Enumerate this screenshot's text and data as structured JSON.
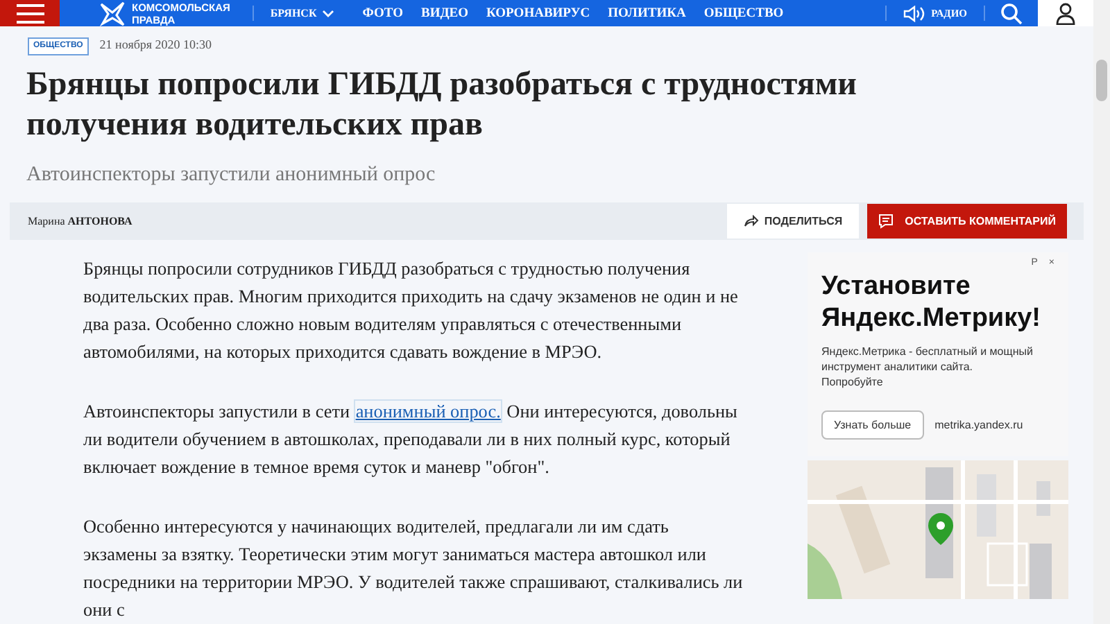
{
  "header": {
    "logo_line_1": "КОМСОМОЛЬСКАЯ",
    "logo_line_2": "ПРАВДА",
    "region": "БРЯНСК",
    "nav": [
      "ФОТО",
      "ВИДЕО",
      "КОРОНАВИРУС",
      "ПОЛИТИКА",
      "ОБЩЕСТВО"
    ],
    "radio": "РАДИО"
  },
  "article": {
    "tag": "ОБЩЕСТВО",
    "date": "21 ноября 2020 10:30",
    "title": "Брянцы попросили ГИБДД разобраться с трудностями получения водительских прав",
    "subtitle": "Автоинспекторы запустили анонимный опрос",
    "author_first": "Марина",
    "author_last": "АНТОНОВА",
    "share": "ПОДЕЛИТЬСЯ",
    "comment": "ОСТАВИТЬ КОММЕНТАРИЙ",
    "paragraphs": [
      {
        "parts": [
          {
            "text": "Брянцы попросили сотрудников ГИБДД разобраться с трудностью получения водительских прав. Многим приходится приходить на сдачу экзаменов не один и не два раза. Особенно сложно новым водителям управляться с отечественными автомобилями, на которых приходится сдавать вождение в МРЭО."
          }
        ]
      },
      {
        "parts": [
          {
            "text": "Автоинспекторы запустили в сети "
          },
          {
            "text": "анонимный опрос.",
            "link": true
          },
          {
            "text": " Они интересуются, довольны ли водители обучением в автошколах, преподавали ли в них полный курс, который включает вождение в темное время суток и маневр \"обгон\"."
          }
        ]
      },
      {
        "parts": [
          {
            "text": "Особенно интересуются у начинающих водителей, предлагали ли им сдать экзамены за взятку. Теоретически этим могут заниматься мастера автошкол или посредники на территории МРЭО. У водителей также спрашивают, сталкивались ли они с"
          }
        ]
      }
    ]
  },
  "ad": {
    "marker": "Р",
    "close": "×",
    "title": "Установите Яндекс.Метрику!",
    "text": "Яндекс.Метрика - бесплатный и мощный инструмент аналитики сайта. Попробуйте",
    "button": "Узнать больше",
    "domain": "metrika.yandex.ru"
  }
}
